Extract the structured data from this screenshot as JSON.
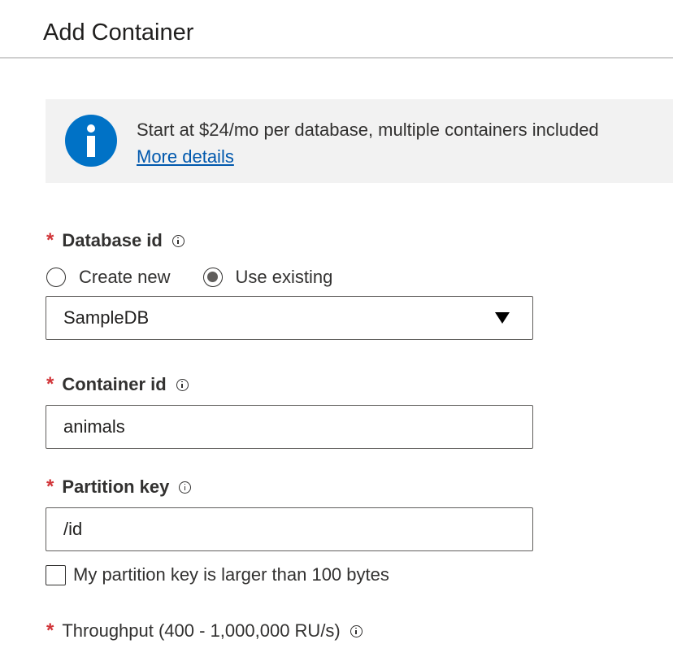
{
  "panel": {
    "title": "Add Container"
  },
  "info": {
    "icon": "info-icon",
    "text": "Start at $24/mo per database, multiple containers included",
    "link": "More details"
  },
  "database": {
    "label": "Database id",
    "required_mark": "*",
    "options": [
      "Create new",
      "Use existing"
    ],
    "selected_option": "Use existing",
    "value": "SampleDB"
  },
  "container": {
    "label": "Container id",
    "required_mark": "*",
    "value": "animals"
  },
  "partition": {
    "label": "Partition key",
    "required_mark": "*",
    "value": "/id",
    "large_key_label": "My partition key is larger than 100 bytes",
    "large_key_checked": false
  },
  "throughput": {
    "label": "Throughput (400 - 1,000,000 RU/s)",
    "required_mark": "*"
  },
  "colors": {
    "accent": "#0072c6",
    "link": "#0058ad",
    "required": "#d13438",
    "banner_bg": "#f2f2f2"
  }
}
